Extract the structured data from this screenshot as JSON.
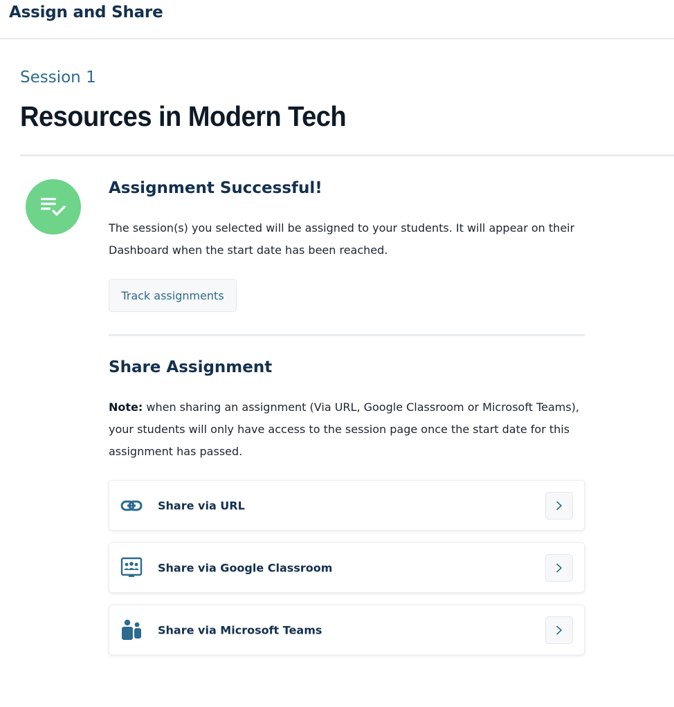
{
  "header": {
    "title": "Assign and Share"
  },
  "session": {
    "label": "Session 1",
    "title": "Resources in Modern Tech"
  },
  "success": {
    "icon": "checklist-icon",
    "heading": "Assignment Successful!",
    "text": "The session(s) you selected will be assigned to your students. It will appear on their Dashboard when the start date has been reached.",
    "track_button": "Track assignments"
  },
  "share": {
    "heading": "Share Assignment",
    "note_label": "Note:",
    "note_text": " when sharing an assignment (Via URL, Google Classroom or Microsoft Teams), your students will only have access to the session page once the start date for this assignment has passed.",
    "options": [
      {
        "label": "Share via URL",
        "icon": "link-icon"
      },
      {
        "label": "Share via Google Classroom",
        "icon": "google-classroom-icon"
      },
      {
        "label": "Share via Microsoft Teams",
        "icon": "microsoft-teams-icon"
      }
    ]
  },
  "colors": {
    "navy": "#14304f",
    "accent_blue": "#2c6a8f",
    "success_green": "#6dd48a",
    "divider": "#e8ecef"
  }
}
